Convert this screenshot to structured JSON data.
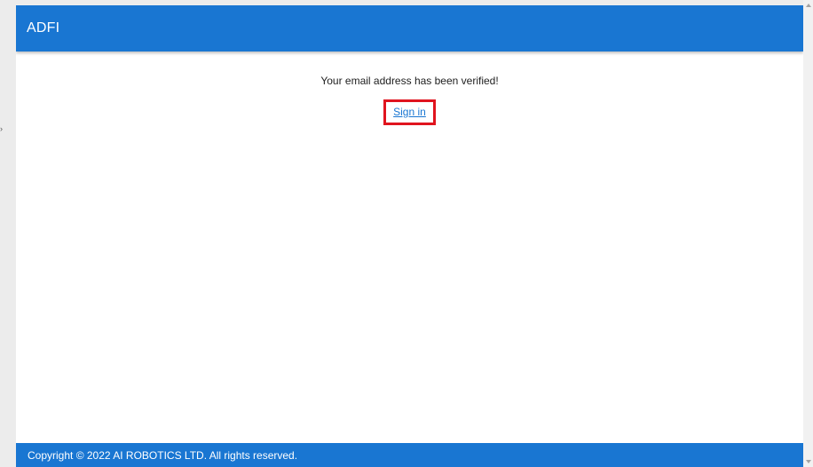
{
  "header": {
    "title": "ADFI"
  },
  "main": {
    "message": "Your email address has been verified!",
    "signin_label": "Sign in"
  },
  "footer": {
    "copyright": "Copyright © 2022 AI ROBOTICS LTD. All rights reserved."
  },
  "colors": {
    "primary": "#1976d2",
    "highlight": "#e0141e",
    "background": "#ffffff"
  },
  "icons": {
    "scroll_up": "chevron-up-icon",
    "scroll_down": "chevron-down-icon"
  }
}
